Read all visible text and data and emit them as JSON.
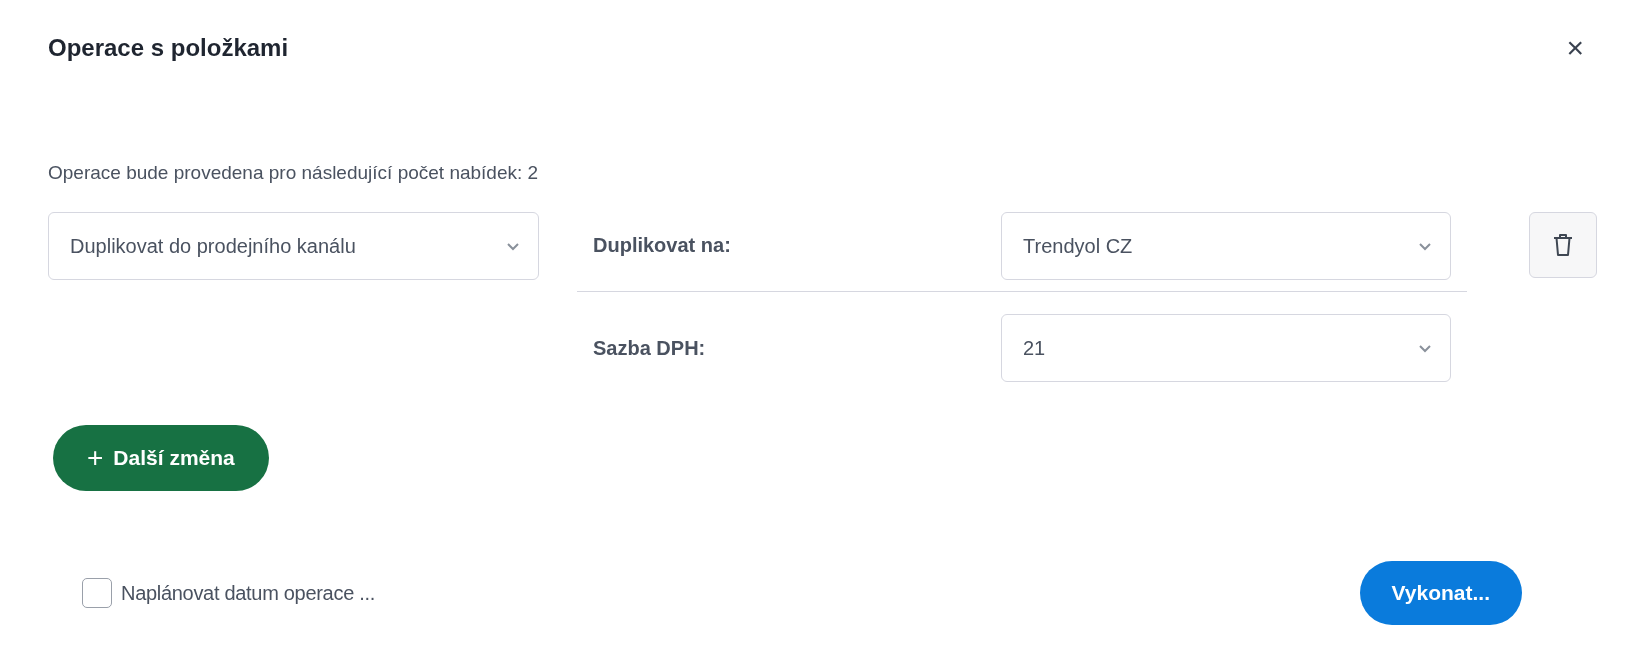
{
  "dialog": {
    "title": "Operace s položkami",
    "close": "×"
  },
  "info": "Operace bude provedena pro následující počet nabídek: 2",
  "operation": {
    "value": "Duplikovat do prodejního kanálu"
  },
  "params": [
    {
      "label": "Duplikovat na:",
      "value": "Trendyol CZ"
    },
    {
      "label": "Sazba DPH:",
      "value": "21"
    }
  ],
  "add_button": {
    "icon": "+",
    "label": "Další změna"
  },
  "schedule": {
    "label": "Naplánovat datum operace ...",
    "checked": false
  },
  "submit_button": "Vykonat..."
}
